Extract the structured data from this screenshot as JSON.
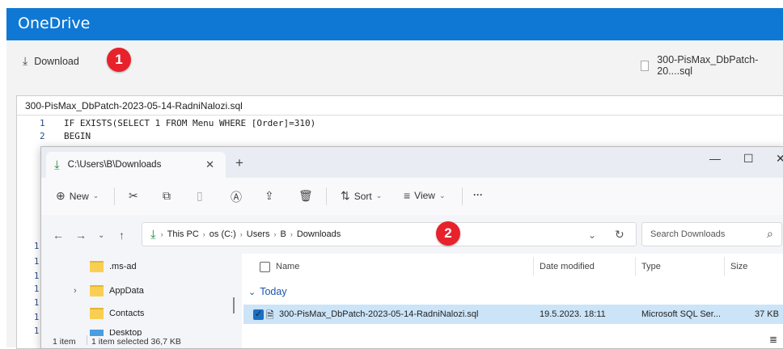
{
  "onedrive": {
    "title": "OneDrive",
    "download_label": "Download",
    "file_label": "300-PisMax_DbPatch-20....sql",
    "preview_filename": "300-PisMax_DbPatch-2023-05-14-RadniNalozi.sql",
    "code_lines": [
      {
        "n": "1",
        "text": "IF EXISTS(SELECT 1 FROM Menu WHERE  [Order]=310)"
      },
      {
        "n": "2",
        "text": "BEGIN"
      }
    ],
    "side_line_numbers": [
      "1",
      "1",
      "1",
      "1",
      "1",
      "1",
      "1"
    ]
  },
  "badges": {
    "one": "1",
    "two": "2"
  },
  "explorer": {
    "tab_title": "C:\\Users\\B\\Downloads",
    "tab_close": "✕",
    "new_tab": "+",
    "window_buttons": {
      "minimize": "—",
      "maximize": "☐",
      "close": "✕"
    },
    "toolbar": {
      "new_label": "New",
      "sort_label": "Sort",
      "view_label": "View",
      "more_label": "···"
    },
    "breadcrumbs": [
      "This PC",
      "os (C:)",
      "Users",
      "B",
      "Downloads"
    ],
    "search_placeholder": "Search Downloads",
    "nav_items": [
      ".ms-ad",
      "AppData",
      "Contacts",
      "Desktop"
    ],
    "columns": {
      "name": "Name",
      "date": "Date modified",
      "type": "Type",
      "size": "Size"
    },
    "group_label": "Today",
    "files": [
      {
        "name": "300-PisMax_DbPatch-2023-05-14-RadniNalozi.sql",
        "date": "19.5.2023. 18:11",
        "type": "Microsoft SQL Ser...",
        "size": "37 KB",
        "selected": true
      }
    ],
    "status": {
      "items": "1 item",
      "selected": "1 item selected  36,7 KB"
    }
  },
  "colors": {
    "onedrive_blue": "#0f78d4",
    "badge_red": "#e8222b",
    "selection": "#cce4f7"
  }
}
